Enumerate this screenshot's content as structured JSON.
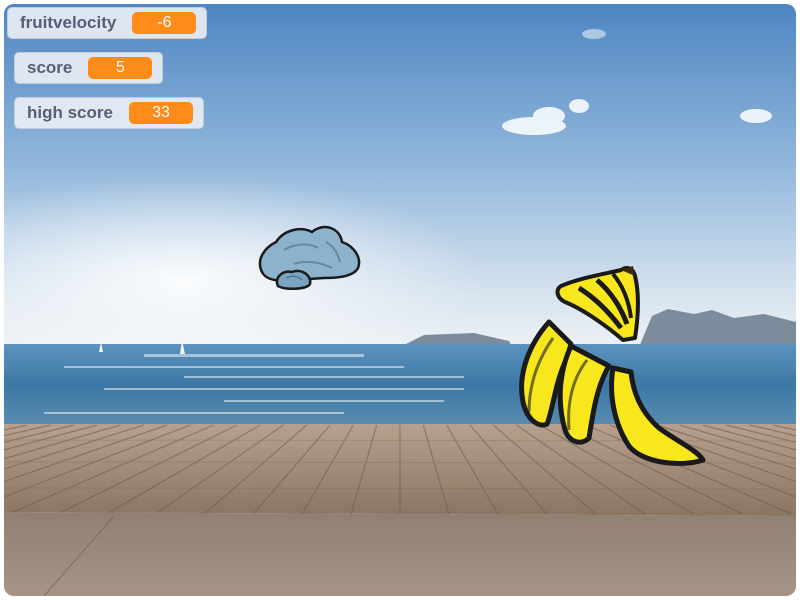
{
  "monitors": [
    {
      "label": "fruitvelocity",
      "value": "-6"
    },
    {
      "label": "score",
      "value": "5"
    },
    {
      "label": "high score",
      "value": "33"
    }
  ],
  "colors": {
    "monitor_value": "#ff8c1a",
    "sky_top": "#5b8fc7",
    "sky_horizon": "#e8eef4",
    "sea": "#3f7ea8",
    "boardwalk": "#a08a78",
    "pavement": "#9a8b7d",
    "rock": "#8db3cc",
    "banana": "#f8e71c"
  },
  "sprites": [
    {
      "name": "rock",
      "icon": "rock-icon"
    },
    {
      "name": "banana bunch (sliced)",
      "icon": "banana-icon"
    }
  ]
}
